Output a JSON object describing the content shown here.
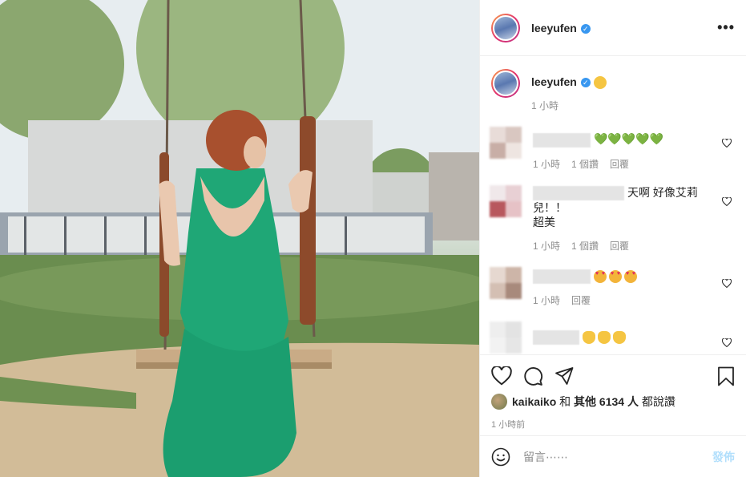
{
  "post": {
    "username": "leeyufen",
    "caption_time": "1 小時",
    "more_label": "•••",
    "verified_glyph": "✓"
  },
  "comments": [
    {
      "text": "💚💚💚💚💚",
      "time": "1 小時",
      "likes": "1 個讚",
      "reply": "回覆",
      "avatar_colors": [
        "#e8dcd8",
        "#d9c7c1",
        "#c8aea6",
        "#eee5e1"
      ]
    },
    {
      "text_line1": "天啊 好像艾莉",
      "text_line2": "兒！！",
      "text_line3": "超美",
      "time": "1 小時",
      "likes": "1 個讚",
      "reply": "回覆",
      "avatar_colors": [
        "#f0e8ea",
        "#e8d0d4",
        "#b8585e",
        "#e6c2c6"
      ]
    },
    {
      "time": "1 小時",
      "reply": "回覆",
      "avatar_colors": [
        "#e6d8d0",
        "#cdb5a8",
        "#d4bfb3",
        "#a88a7c"
      ]
    },
    {
      "avatar_colors": [
        "#eeeeee",
        "#e3e3e3",
        "#f2f2f2",
        "#e6e6e6"
      ]
    }
  ],
  "likes": {
    "user": "kaikaiko",
    "and": "和",
    "others": "其他 6134 人",
    "suffix": "都說讚"
  },
  "post_time": "1 小時前",
  "add_comment": {
    "placeholder": "留言⋯⋯",
    "post_label": "發佈"
  }
}
